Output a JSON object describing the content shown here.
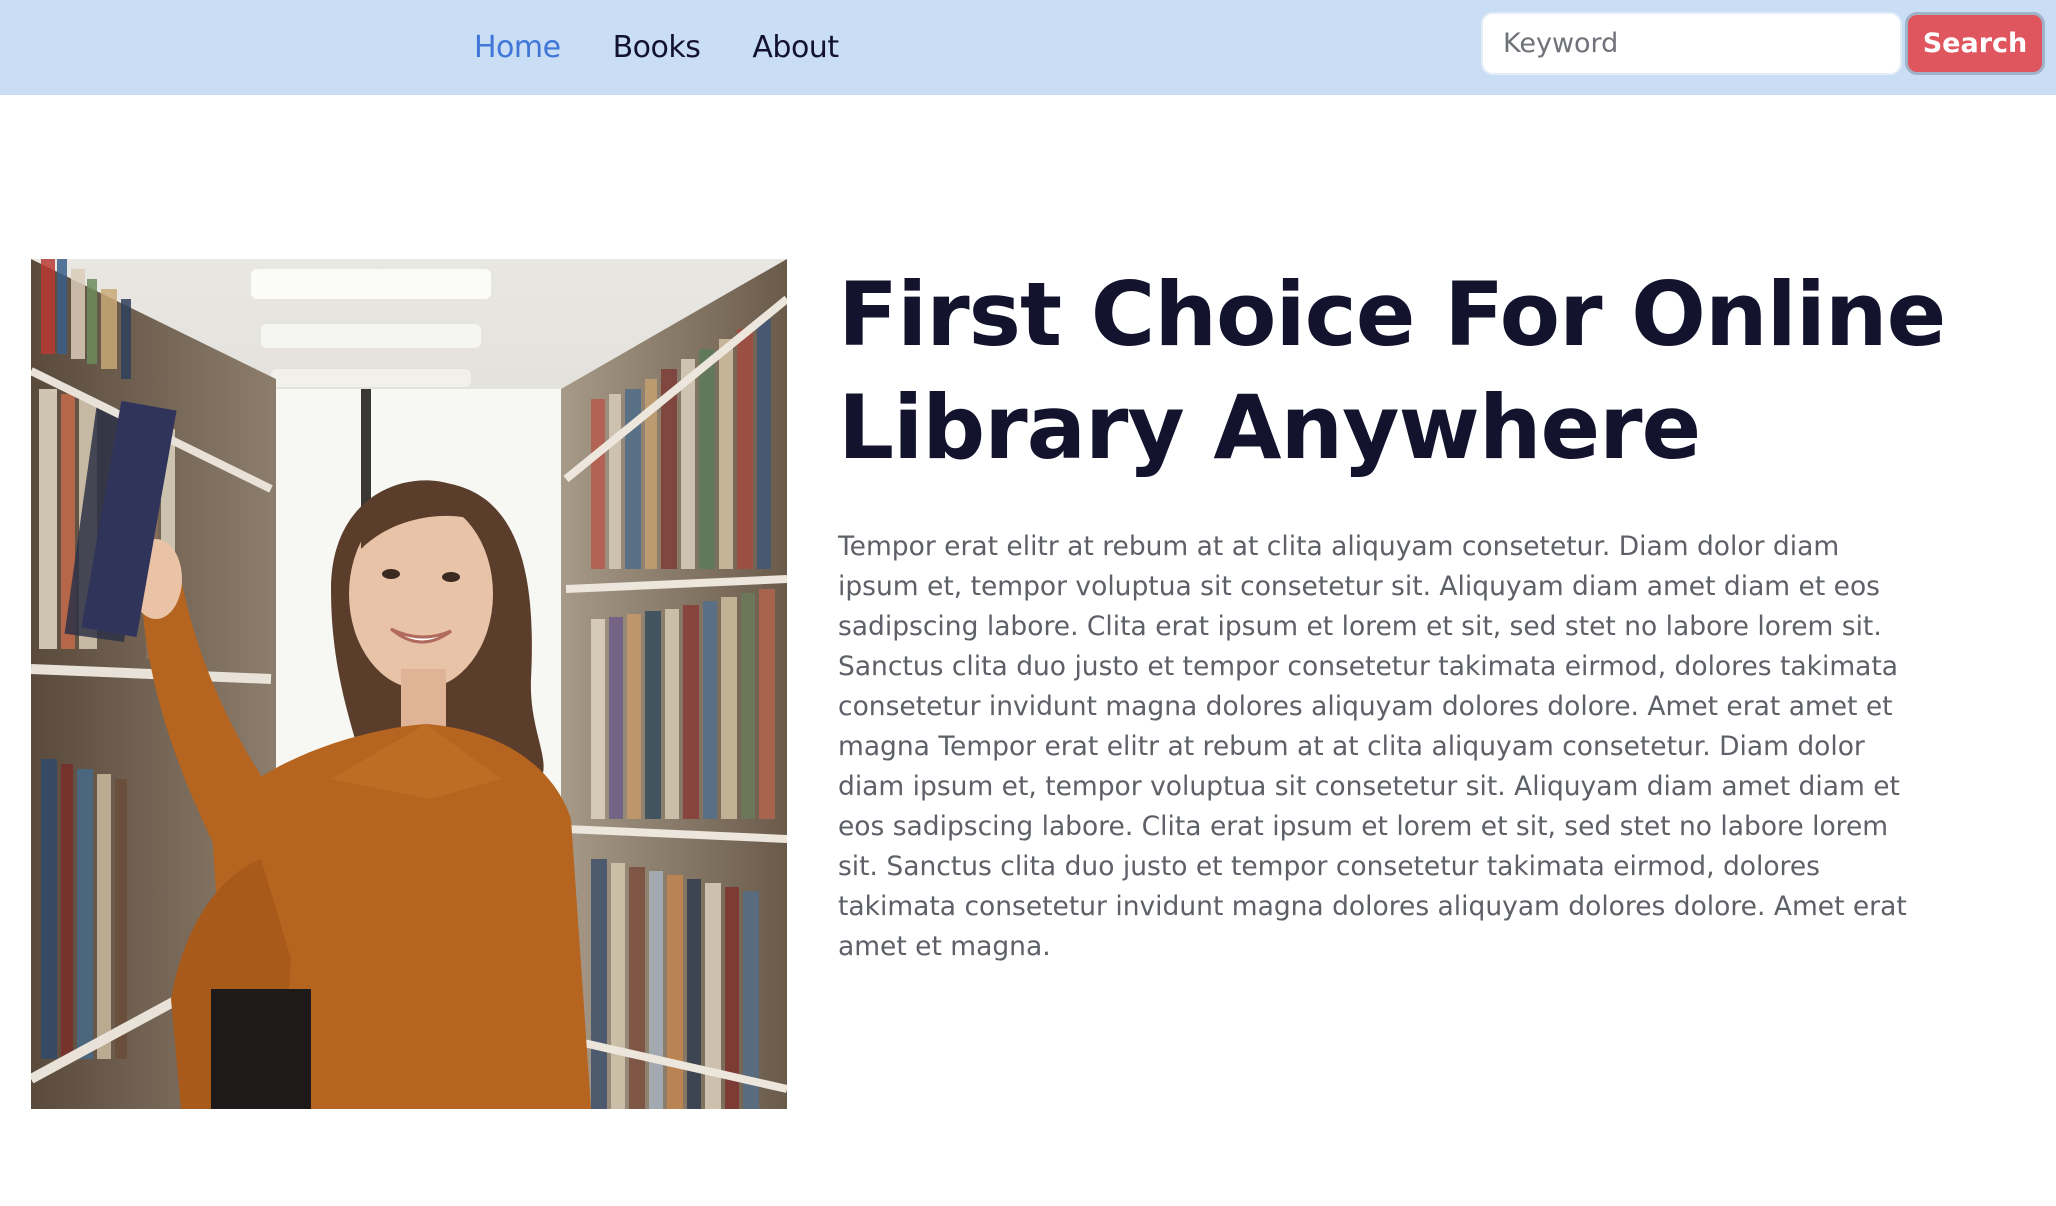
{
  "nav": {
    "links": [
      {
        "label": "Home",
        "active": true
      },
      {
        "label": "Books",
        "active": false
      },
      {
        "label": "About",
        "active": false
      }
    ]
  },
  "search": {
    "placeholder": "Keyword",
    "value": "",
    "button_label": "Search"
  },
  "hero": {
    "image_alt": "Woman smiling and taking a book from a library shelf",
    "title": "First Choice For Online Library Anywhere",
    "paragraph": "Tempor erat elitr at rebum at at clita aliquyam consetetur. Diam dolor diam ipsum et, tempor voluptua sit consetetur sit. Aliquyam diam amet diam et eos sadipscing labore. Clita erat ipsum et lorem et sit, sed stet no labore lorem sit. Sanctus clita duo justo et tempor consetetur takimata eirmod, dolores takimata consetetur invidunt magna dolores aliquyam dolores dolore. Amet erat amet et magna Tempor erat elitr at rebum at at clita aliquyam consetetur. Diam dolor diam ipsum et, tempor voluptua sit consetetur sit. Aliquyam diam amet diam et eos sadipscing labore. Clita erat ipsum et lorem et sit, sed stet no labore lorem sit. Sanctus clita duo justo et tempor consetetur takimata eirmod, dolores takimata consetetur invidunt magna dolores aliquyam dolores dolore. Amet erat amet et magna."
  },
  "colors": {
    "navbar_bg": "#c9ddf5",
    "nav_active": "#3f76d8",
    "nav_text": "#14132e",
    "search_button_bg": "#e0565f",
    "title": "#14132e",
    "body_text": "#5d6066"
  }
}
